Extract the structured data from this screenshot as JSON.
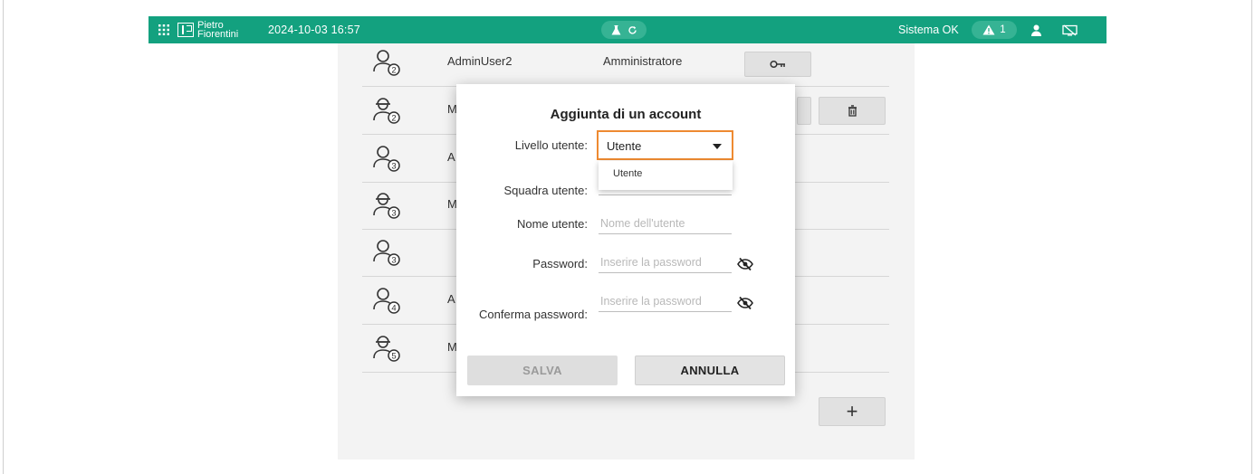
{
  "topbar": {
    "logo_line1": "Pietro",
    "logo_line2": "Fiorentini",
    "datetime": "2024-10-03 16:57",
    "status": "Sistema OK",
    "alarm_count": "1",
    "bg_color": "#13a17f"
  },
  "users": [
    {
      "name": "AdminUser2",
      "role": "Amministratore",
      "level": "2",
      "kind": "admin",
      "truncated": ""
    },
    {
      "name": "M",
      "role": "",
      "level": "2",
      "kind": "maint",
      "truncated": "M"
    },
    {
      "name": "A",
      "role": "",
      "level": "3",
      "kind": "admin",
      "truncated": "A"
    },
    {
      "name": "M",
      "role": "",
      "level": "3",
      "kind": "maint",
      "truncated": "M"
    },
    {
      "name": "",
      "role": "",
      "level": "3",
      "kind": "admin",
      "truncated": ""
    },
    {
      "name": "A",
      "role": "",
      "level": "4",
      "kind": "admin",
      "truncated": "A"
    },
    {
      "name": "M",
      "role": "",
      "level": "5",
      "kind": "maint",
      "truncated": "M"
    }
  ],
  "add_button": "+",
  "dialog": {
    "title": "Aggiunta di un account",
    "level_label": "Livello utente:",
    "level_value": "Utente",
    "level_options": [
      "Utente"
    ],
    "team_label": "Squadra utente:",
    "username_label": "Nome utente:",
    "username_placeholder": "Nome dell'utente",
    "password_label": "Password:",
    "password_placeholder": "Inserire la password",
    "confirm_label": "Conferma password:",
    "confirm_placeholder": "Inserire la password",
    "save_label": "SALVA",
    "cancel_label": "ANNULLA",
    "highlight_color": "#ee8a31"
  }
}
